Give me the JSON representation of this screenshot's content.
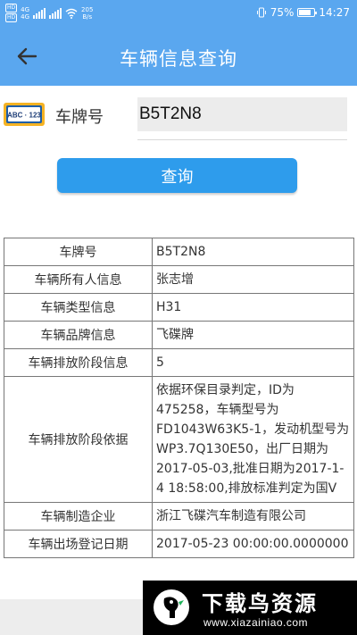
{
  "status_bar": {
    "sim1": "HD",
    "sim2": "HD",
    "net1": "4G",
    "net2": "4G",
    "speed_value": "205",
    "speed_unit": "B/s",
    "battery": "75%",
    "time": "14:27"
  },
  "app_bar": {
    "title": "车辆信息查询"
  },
  "plate_search": {
    "label": "车牌号",
    "value": "B5T2N8",
    "icon_text": "ABC · 123",
    "button_label": "查询"
  },
  "vehicle_info": {
    "rows": [
      {
        "label": "车牌号",
        "value": "B5T2N8"
      },
      {
        "label": "车辆所有人信息",
        "value": "张志增"
      },
      {
        "label": "车辆类型信息",
        "value": "H31"
      },
      {
        "label": "车辆品牌信息",
        "value": "飞碟牌"
      },
      {
        "label": "车辆排放阶段信息",
        "value": "5"
      },
      {
        "label": "车辆排放阶段依据",
        "value": "依据环保目录判定，ID为475258，车辆型号为FD1043W63K5-1，发动机型号为WP3.7Q130E50，出厂日期为2017-05-03,批准日期为2017-1-4 18:58:00,排放标准判定为国V"
      },
      {
        "label": "车辆制造企业",
        "value": "浙江飞碟汽车制造有限公司"
      },
      {
        "label": "车辆出场登记日期",
        "value": "2017-05-23 00:00:00.0000000"
      }
    ]
  },
  "watermark": {
    "title": "下载鸟资源",
    "url": "www.xiazainiao.com"
  },
  "colors": {
    "app_bar": "#5aa7ef",
    "button": "#2e9cec"
  }
}
